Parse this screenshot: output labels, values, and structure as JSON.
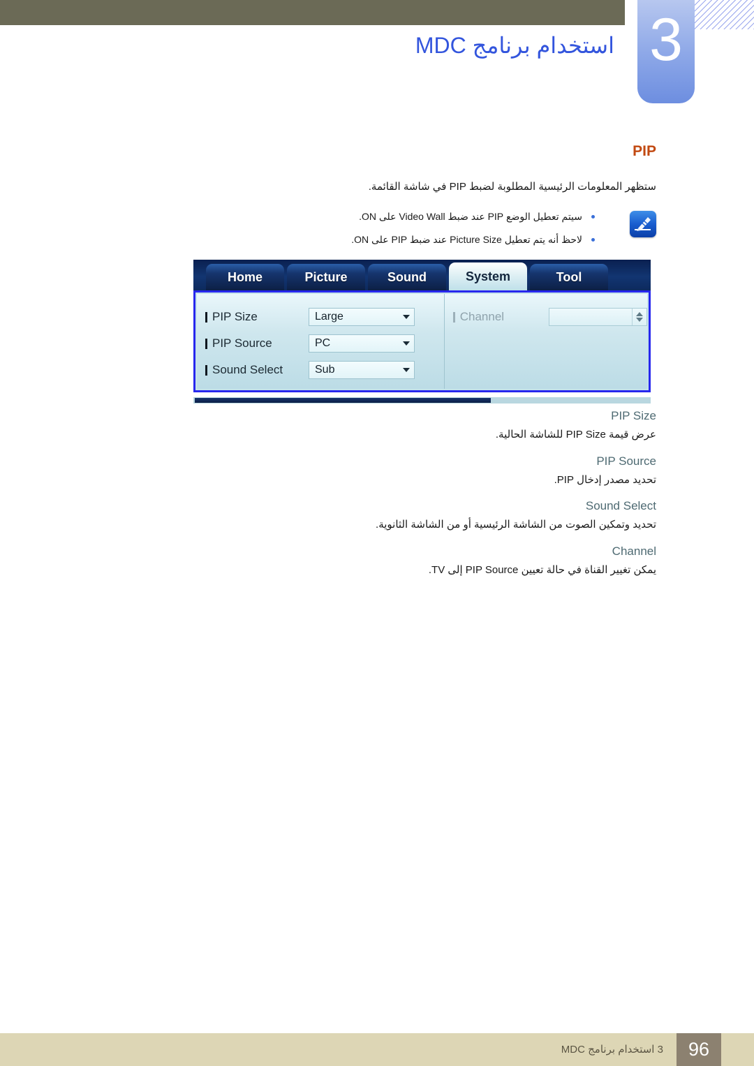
{
  "header": {
    "chapter_number": "3",
    "title": "استخدام برنامج MDC"
  },
  "section": {
    "heading": "PIP",
    "intro": "ستظهر المعلومات الرئيسية المطلوبة لضبط PIP في شاشة القائمة.",
    "notes": [
      "سيتم تعطيل الوضع PIP عند ضبط Video Wall على ON.",
      "لاحظ أنه يتم تعطيل Picture Size عند ضبط PIP على ON."
    ],
    "note_icon": "note-pen-icon"
  },
  "mdc_dialog": {
    "tabs": [
      {
        "label": "Home",
        "active": false
      },
      {
        "label": "Picture",
        "active": false
      },
      {
        "label": "Sound",
        "active": false
      },
      {
        "label": "System",
        "active": true
      },
      {
        "label": "Tool",
        "active": false
      }
    ],
    "fields": [
      {
        "label": "PIP Size",
        "value": "Large",
        "control": "dropdown",
        "disabled": false
      },
      {
        "label": "PIP Source",
        "value": "PC",
        "control": "dropdown",
        "disabled": false
      },
      {
        "label": "Sound Select",
        "value": "Sub",
        "control": "dropdown",
        "disabled": false
      }
    ],
    "right_fields": [
      {
        "label": "Channel",
        "value": "",
        "control": "spinner",
        "disabled": true
      }
    ],
    "accent_border_color": "#2727ee",
    "panel_bg_color": "#c5e2ea",
    "tabbar_color": "#123571"
  },
  "descriptions": [
    {
      "term": "PIP Size",
      "text": "عرض قيمة PIP Size للشاشة الحالية."
    },
    {
      "term": "PIP Source",
      "text": "تحديد مصدر إدخال PIP."
    },
    {
      "term": "Sound Select",
      "text": "تحديد وتمكين الصوت من الشاشة الرئيسية أو من الشاشة الثانوية."
    },
    {
      "term": "Channel",
      "text": "يمكن تغيير القناة في حالة تعيين PIP Source إلى TV."
    }
  ],
  "footer": {
    "text": "3 استخدام برنامج MDC",
    "page_number": "96"
  },
  "colors": {
    "header_bar": "#6b6a56",
    "title_blue": "#3355dd",
    "heading_orange": "#c24a12",
    "term_gray": "#4e6a72",
    "footer_bg": "#ddd6b5",
    "footer_page_bg": "#8c8170"
  }
}
